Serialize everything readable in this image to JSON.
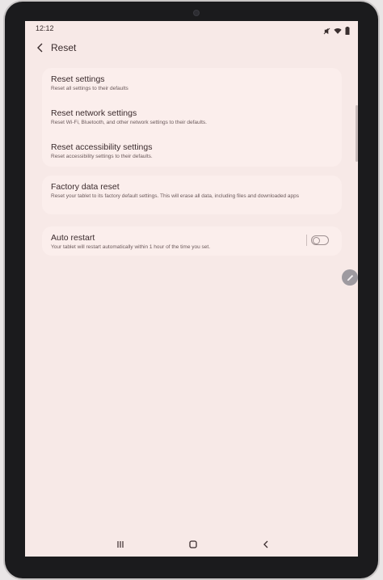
{
  "status_bar": {
    "time": "12:12",
    "icons": [
      "mute-icon",
      "wifi-icon",
      "battery-icon"
    ]
  },
  "header": {
    "title": "Reset",
    "back_icon": "back-arrow-icon"
  },
  "reset_group": {
    "items": [
      {
        "title": "Reset settings",
        "description": "Reset all settings to their defaults"
      },
      {
        "title": "Reset network settings",
        "description": "Reset Wi-Fi, Bluetooth, and other network settings to their defaults."
      },
      {
        "title": "Reset accessibility settings",
        "description": "Reset accessibility settings to their defaults."
      }
    ]
  },
  "factory_reset": {
    "title": "Factory data reset",
    "description": "Reset your tablet to its factory default settings. This will erase all data, including files and downloaded apps"
  },
  "auto_restart": {
    "title": "Auto restart",
    "description": "Your tablet will restart automatically within 1 hour of the time you set.",
    "enabled": false
  },
  "edge_panel": {
    "icon": "pencil-icon"
  },
  "nav_bar": {
    "buttons": [
      "recents-icon",
      "home-icon",
      "back-icon"
    ]
  },
  "colors": {
    "background": "#f7e9e7",
    "card": "#fbeeec",
    "text_primary": "#3b2b2d",
    "text_secondary": "#6b5a5b"
  }
}
